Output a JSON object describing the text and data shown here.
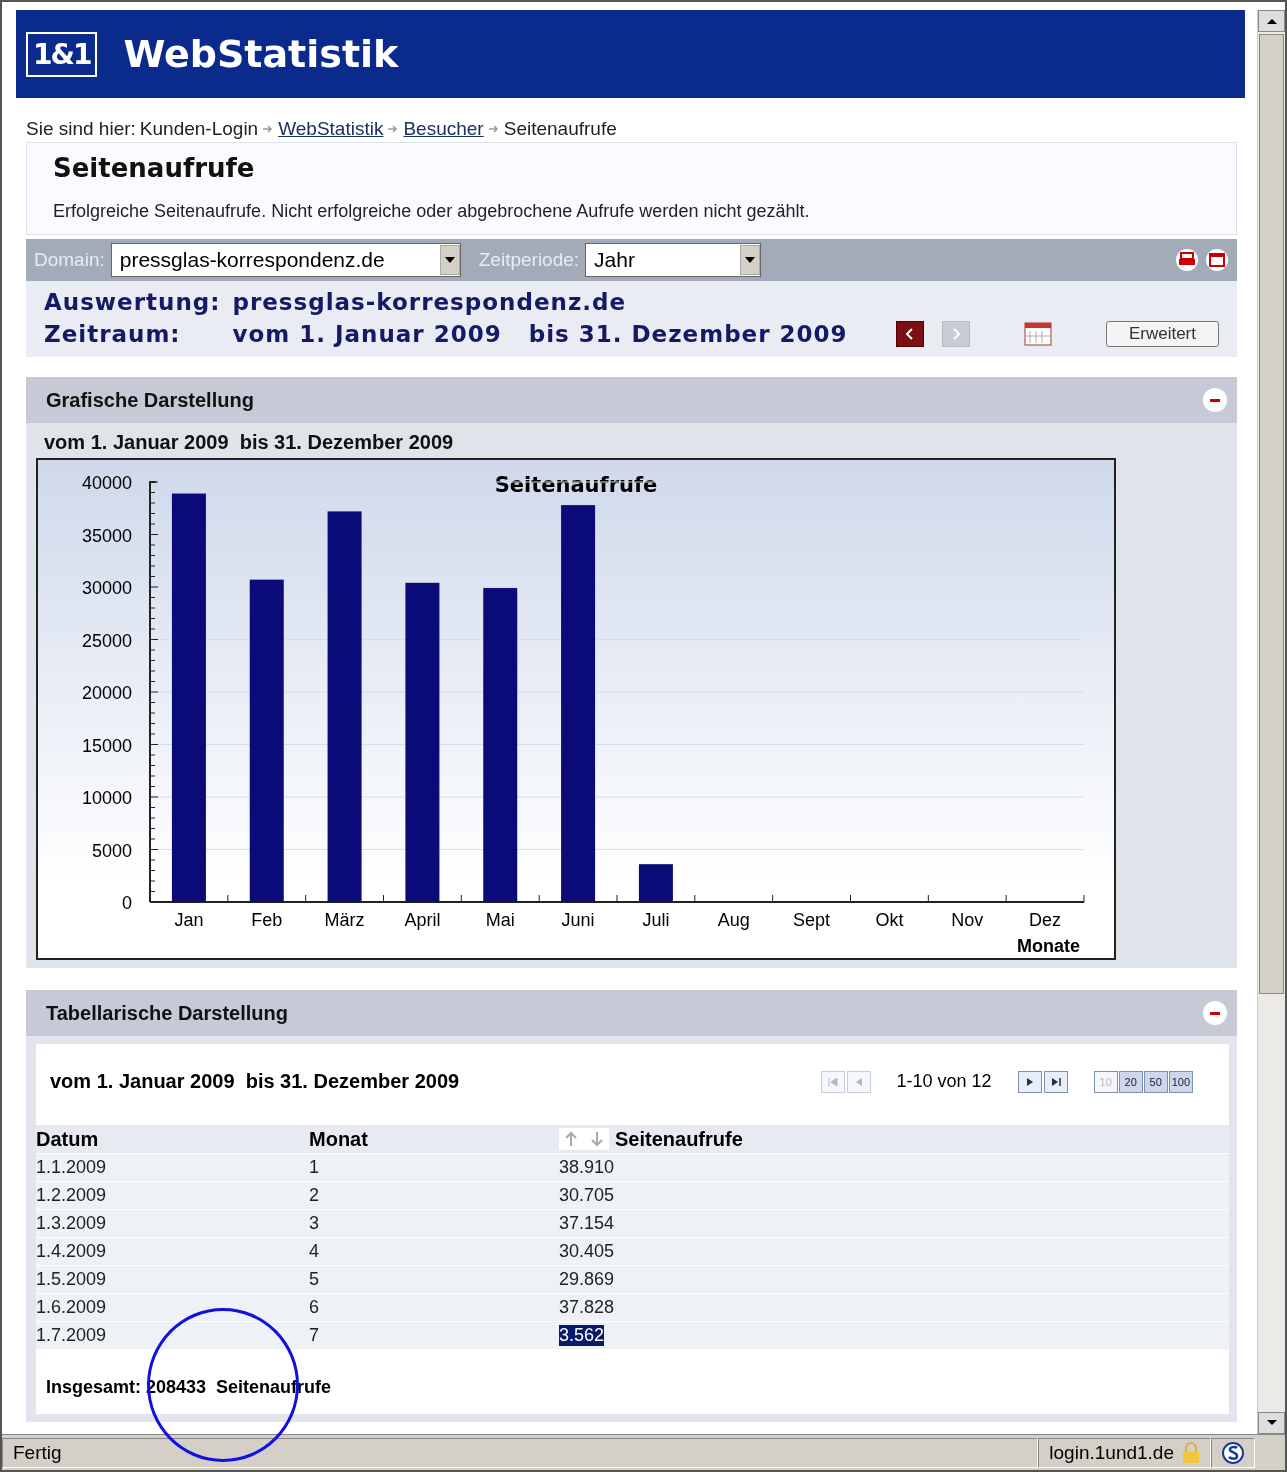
{
  "header": {
    "logo": "1&1",
    "title": "WebStatistik"
  },
  "breadcrumb": {
    "label": "Sie sind hier:",
    "items": [
      {
        "text": "Kunden-Login",
        "kind": "text"
      },
      {
        "text": "WebStatistik",
        "kind": "link"
      },
      {
        "text": "Besucher",
        "kind": "link"
      },
      {
        "text": "Seitenaufrufe",
        "kind": "text"
      }
    ]
  },
  "page": {
    "title": "Seitenaufrufe",
    "description": "Erfolgreiche Seitenaufrufe. Nicht erfolgreiche oder abgebrochene Aufrufe werden nicht gezählt."
  },
  "filters": [
    {
      "label": "Domain:",
      "value": "pressglas-korrespondenz.de"
    },
    {
      "label": "Zeitperiode:",
      "value": "Jahr"
    }
  ],
  "info": {
    "auswertung_label": "Auswertung:",
    "auswertung": "pressglas-korrespondenz.de",
    "zeitraum_label": "Zeitraum:",
    "zeitraum": "vom 1. Januar 2009   bis 31. Dezember 2009",
    "prev_disabled": false,
    "next_disabled": true,
    "button": "Erweitert"
  },
  "graph_section": {
    "title": "Grafische Darstellung",
    "expanded": true,
    "subtitle": "vom 1. Januar 2009  bis 31. Dezember 2009",
    "chart_data": {
      "type": "bar",
      "title": "Seitenaufrufe",
      "xlabel": "Monate",
      "categories": [
        "Jan",
        "Feb",
        "März",
        "April",
        "Mai",
        "Juni",
        "Juli",
        "Aug",
        "Sept",
        "Okt",
        "Nov",
        "Dez"
      ],
      "values": [
        38900,
        30700,
        37200,
        30400,
        29900,
        37800,
        3600,
        null,
        null,
        null,
        null,
        null
      ],
      "grid": true,
      "ylim": [
        0,
        40000
      ],
      "yticks": [
        0,
        5000,
        10000,
        15000,
        20000,
        25000,
        30000,
        35000,
        40000
      ]
    }
  },
  "table_section": {
    "title": "Tabellarische Darstellung",
    "expanded": true,
    "subtitle": "vom 1. Januar 2009  bis 31. Dezember 2009",
    "pager": "1-10 von 12",
    "first_disabled": true,
    "last_disabled": false,
    "page_sizes": [
      {
        "label": "10",
        "selected": true
      },
      {
        "label": "20",
        "selected": false
      },
      {
        "label": "50",
        "selected": false
      },
      {
        "label": "100",
        "selected": false
      }
    ],
    "columns": [
      "Datum",
      "Monat",
      "Seitenaufrufe"
    ],
    "rows": [
      {
        "datum": "1.1.2009",
        "monat": "1",
        "value": "38.910",
        "selected": false
      },
      {
        "datum": "1.2.2009",
        "monat": "2",
        "value": "30.705",
        "selected": false
      },
      {
        "datum": "1.3.2009",
        "monat": "3",
        "value": "37.154",
        "selected": false
      },
      {
        "datum": "1.4.2009",
        "monat": "4",
        "value": "30.405",
        "selected": false
      },
      {
        "datum": "1.5.2009",
        "monat": "5",
        "value": "29.869",
        "selected": false
      },
      {
        "datum": "1.6.2009",
        "monat": "6",
        "value": "37.828",
        "selected": false
      },
      {
        "datum": "1.7.2009",
        "monat": "7",
        "value": "3.562",
        "selected": true
      }
    ],
    "total": "Insgesamt: 208433  Seitenaufrufe"
  },
  "status_bar": {
    "text": "Fertig",
    "host": "login.1und1.de"
  }
}
